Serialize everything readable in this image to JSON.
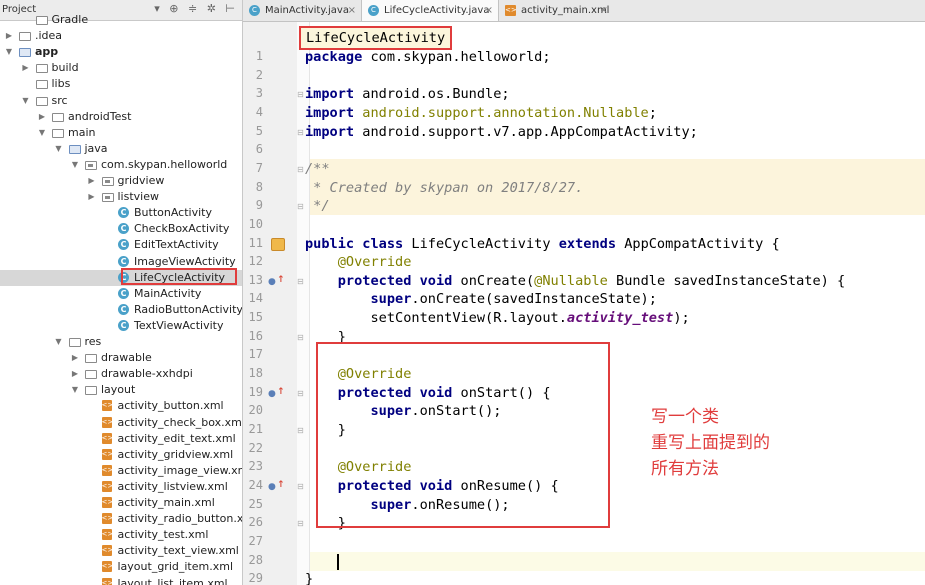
{
  "project_panel": {
    "title": "Project",
    "toolbar_icons": [
      "settings-icon",
      "collapse-icon",
      "gear-icon",
      "hide-icon"
    ],
    "items": [
      {
        "label": "Gradle",
        "depth": 1,
        "arrow": "",
        "icon": "folder"
      },
      {
        "label": ".idea",
        "depth": 0,
        "arrow": "▶",
        "icon": "folder"
      },
      {
        "label": "app",
        "depth": 0,
        "arrow": "▼",
        "icon": "module",
        "bold": true
      },
      {
        "label": "build",
        "depth": 1,
        "arrow": "▶",
        "icon": "folder"
      },
      {
        "label": "libs",
        "depth": 1,
        "arrow": "",
        "icon": "folder"
      },
      {
        "label": "src",
        "depth": 1,
        "arrow": "▼",
        "icon": "folder"
      },
      {
        "label": "androidTest",
        "depth": 2,
        "arrow": "▶",
        "icon": "folder"
      },
      {
        "label": "main",
        "depth": 2,
        "arrow": "▼",
        "icon": "folder"
      },
      {
        "label": "java",
        "depth": 3,
        "arrow": "▼",
        "icon": "folder-blue"
      },
      {
        "label": "com.skypan.helloworld",
        "depth": 4,
        "arrow": "▼",
        "icon": "package"
      },
      {
        "label": "gridview",
        "depth": 5,
        "arrow": "▶",
        "icon": "package"
      },
      {
        "label": "listview",
        "depth": 5,
        "arrow": "▶",
        "icon": "package"
      },
      {
        "label": "ButtonActivity",
        "depth": 6,
        "arrow": "",
        "icon": "class"
      },
      {
        "label": "CheckBoxActivity",
        "depth": 6,
        "arrow": "",
        "icon": "class"
      },
      {
        "label": "EditTextActivity",
        "depth": 6,
        "arrow": "",
        "icon": "class"
      },
      {
        "label": "ImageViewActivity",
        "depth": 6,
        "arrow": "",
        "icon": "class"
      },
      {
        "label": "LifeCycleActivity",
        "depth": 6,
        "arrow": "",
        "icon": "class",
        "selected": true
      },
      {
        "label": "MainActivity",
        "depth": 6,
        "arrow": "",
        "icon": "class"
      },
      {
        "label": "RadioButtonActivity",
        "depth": 6,
        "arrow": "",
        "icon": "class"
      },
      {
        "label": "TextViewActivity",
        "depth": 6,
        "arrow": "",
        "icon": "class"
      },
      {
        "label": "res",
        "depth": 3,
        "arrow": "▼",
        "icon": "folder-res"
      },
      {
        "label": "drawable",
        "depth": 4,
        "arrow": "▶",
        "icon": "folder"
      },
      {
        "label": "drawable-xxhdpi",
        "depth": 4,
        "arrow": "▶",
        "icon": "folder"
      },
      {
        "label": "layout",
        "depth": 4,
        "arrow": "▼",
        "icon": "folder"
      },
      {
        "label": "activity_button.xml",
        "depth": 5,
        "arrow": "",
        "icon": "xml"
      },
      {
        "label": "activity_check_box.xml",
        "depth": 5,
        "arrow": "",
        "icon": "xml"
      },
      {
        "label": "activity_edit_text.xml",
        "depth": 5,
        "arrow": "",
        "icon": "xml"
      },
      {
        "label": "activity_gridview.xml",
        "depth": 5,
        "arrow": "",
        "icon": "xml"
      },
      {
        "label": "activity_image_view.xml",
        "depth": 5,
        "arrow": "",
        "icon": "xml"
      },
      {
        "label": "activity_listview.xml",
        "depth": 5,
        "arrow": "",
        "icon": "xml"
      },
      {
        "label": "activity_main.xml",
        "depth": 5,
        "arrow": "",
        "icon": "xml"
      },
      {
        "label": "activity_radio_button.xml",
        "depth": 5,
        "arrow": "",
        "icon": "xml"
      },
      {
        "label": "activity_test.xml",
        "depth": 5,
        "arrow": "",
        "icon": "xml"
      },
      {
        "label": "activity_text_view.xml",
        "depth": 5,
        "arrow": "",
        "icon": "xml"
      },
      {
        "label": "layout_grid_item.xml",
        "depth": 5,
        "arrow": "",
        "icon": "xml"
      },
      {
        "label": "layout_list_item.xml",
        "depth": 5,
        "arrow": "",
        "icon": "xml"
      }
    ]
  },
  "tabs": [
    {
      "label": "MainActivity.java",
      "icon": "class",
      "active": false
    },
    {
      "label": "LifeCycleActivity.java",
      "icon": "class",
      "active": true
    },
    {
      "label": "activity_main.xml",
      "icon": "xml",
      "active": false
    }
  ],
  "breadcrumb": "LifeCycleActivity",
  "code_lines": [
    {
      "n": "1",
      "html": "<span class=\"kw\">package</span> com.skypan.helloworld;"
    },
    {
      "n": "2",
      "html": ""
    },
    {
      "n": "3",
      "html": "<span class=\"kw\">import</span> android.os.Bundle;",
      "fold": "⊟"
    },
    {
      "n": "4",
      "html": "<span class=\"kw\">import</span> <span class=\"gray-imp\">android.support.annotation.Nullable</span>;"
    },
    {
      "n": "5",
      "html": "<span class=\"kw\">import</span> android.support.v7.app.AppCompatActivity;",
      "fold": "⊟"
    },
    {
      "n": "6",
      "html": ""
    },
    {
      "n": "7",
      "html": "<span class=\"cm\">/**</span>",
      "fold": "⊟"
    },
    {
      "n": "8",
      "html": "<span class=\"cm\"> * Created by skypan on 2017/8/27.</span>"
    },
    {
      "n": "9",
      "html": "<span class=\"cm\"> */</span>",
      "fold": "⊟"
    },
    {
      "n": "10",
      "html": ""
    },
    {
      "n": "11",
      "html": "<span class=\"kw\">public class</span> LifeCycleActivity <span class=\"kw\">extends</span> AppCompatActivity {",
      "mark": "class"
    },
    {
      "n": "12",
      "html": "    <span class=\"ann\">@Override</span>"
    },
    {
      "n": "13",
      "html": "    <span class=\"kw\">protected void</span> onCreate(<span class=\"ann\">@Nullable</span> Bundle savedInstanceState) {",
      "mark": "override",
      "fold": "⊟"
    },
    {
      "n": "14",
      "html": "        <span class=\"kw\">super</span>.onCreate(savedInstanceState);"
    },
    {
      "n": "15",
      "html": "        setContentView(R.layout.<span class=\"fld\">activity_test</span>);"
    },
    {
      "n": "16",
      "html": "    }",
      "fold": "⊟"
    },
    {
      "n": "17",
      "html": ""
    },
    {
      "n": "18",
      "html": "    <span class=\"ann\">@Override</span>"
    },
    {
      "n": "19",
      "html": "    <span class=\"kw\">protected void</span> onStart() {",
      "mark": "override",
      "fold": "⊟"
    },
    {
      "n": "20",
      "html": "        <span class=\"kw\">super</span>.onStart();"
    },
    {
      "n": "21",
      "html": "    }",
      "fold": "⊟"
    },
    {
      "n": "22",
      "html": ""
    },
    {
      "n": "23",
      "html": "    <span class=\"ann\">@Override</span>"
    },
    {
      "n": "24",
      "html": "    <span class=\"kw\">protected void</span> onResume() {",
      "mark": "override",
      "fold": "⊟"
    },
    {
      "n": "25",
      "html": "        <span class=\"kw\">super</span>.onResume();"
    },
    {
      "n": "26",
      "html": "    }",
      "fold": "⊟"
    },
    {
      "n": "27",
      "html": ""
    },
    {
      "n": "28",
      "html": ""
    },
    {
      "n": "29",
      "html": "}"
    }
  ],
  "annotation_note": [
    "写一个类",
    "重写上面提到的",
    "所有方法"
  ],
  "colors": {
    "annotation_red": "#e03c3c",
    "keyword": "#000080",
    "annotation": "#808000",
    "comment": "#808080"
  }
}
